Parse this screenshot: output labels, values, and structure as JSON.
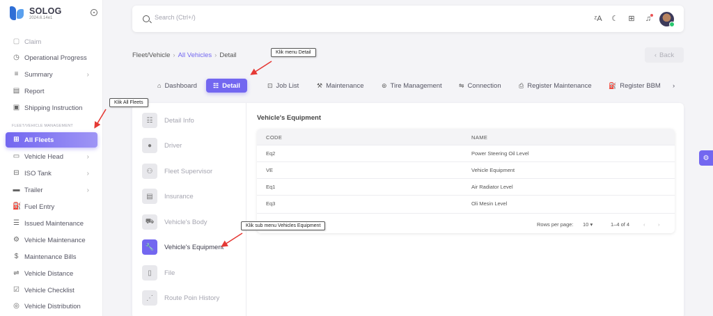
{
  "app": {
    "name": "SOLOG",
    "version": "2024.6.14e1"
  },
  "sidebar": {
    "items": [
      {
        "label": "Claim",
        "icon": "document-icon",
        "muted": true
      },
      {
        "label": "Operational Progress",
        "icon": "clock-icon"
      },
      {
        "label": "Summary",
        "icon": "summary-icon",
        "chevron": true
      },
      {
        "label": "Report",
        "icon": "report-icon"
      },
      {
        "label": "Shipping Instruction",
        "icon": "instruction-icon"
      }
    ],
    "section_label": "FLEET/VEHICLE MANAGEMENT",
    "fleet_items": [
      {
        "label": "All Fleets",
        "icon": "fleet-icon",
        "active": true
      },
      {
        "label": "Vehicle Head",
        "icon": "truck-icon",
        "chevron": true
      },
      {
        "label": "ISO Tank",
        "icon": "tank-icon",
        "chevron": true
      },
      {
        "label": "Trailer",
        "icon": "trailer-icon",
        "chevron": true
      },
      {
        "label": "Fuel Entry",
        "icon": "fuel-icon"
      },
      {
        "label": "Issued Maintenance",
        "icon": "issued-icon"
      },
      {
        "label": "Vehicle Maintenance",
        "icon": "maintenance-icon"
      },
      {
        "label": "Maintenance Bills",
        "icon": "bill-icon"
      },
      {
        "label": "Vehicle Distance",
        "icon": "distance-icon"
      },
      {
        "label": "Vehicle Checklist",
        "icon": "checklist-icon"
      },
      {
        "label": "Vehicle Distribution",
        "icon": "distribution-icon"
      }
    ]
  },
  "search": {
    "placeholder": "Search (Ctrl+/)"
  },
  "breadcrumb": {
    "root": "Fleet/Vehicle",
    "link": "All Vehicles",
    "current": "Detail"
  },
  "back_label": "Back",
  "tabs": [
    {
      "label": "Dashboard",
      "icon": "home-icon"
    },
    {
      "label": "Detail",
      "icon": "detail-icon",
      "active": true
    },
    {
      "label": "Job List",
      "icon": "job-icon"
    },
    {
      "label": "Maintenance",
      "icon": "maintenance-icon"
    },
    {
      "label": "Tire Management",
      "icon": "tire-icon"
    },
    {
      "label": "Connection",
      "icon": "connection-icon"
    },
    {
      "label": "Register Maintenance",
      "icon": "register-icon"
    },
    {
      "label": "Register BBM",
      "icon": "bbm-icon"
    }
  ],
  "sub_menu": [
    {
      "label": "Detail Info",
      "icon": "info-icon"
    },
    {
      "label": "Driver",
      "icon": "driver-icon"
    },
    {
      "label": "Fleet Supervisor",
      "icon": "supervisor-icon"
    },
    {
      "label": "Insurance",
      "icon": "insurance-icon"
    },
    {
      "label": "Vehicle's Body",
      "icon": "body-icon"
    },
    {
      "label": "Vehicle's Equipment",
      "icon": "wrench-icon",
      "active": true
    },
    {
      "label": "File",
      "icon": "file-icon"
    },
    {
      "label": "Route Poin History",
      "icon": "route-icon"
    }
  ],
  "equipment": {
    "title": "Vehicle's Equipment",
    "columns": [
      "CODE",
      "NAME"
    ],
    "rows": [
      [
        "Eq2",
        "Power Steering Oil Level"
      ],
      [
        "VE",
        "Vehicle Equipment"
      ],
      [
        "Eq1",
        "Air Radiator Level"
      ],
      [
        "Eq3",
        "Oli Mesin Level"
      ]
    ],
    "rows_per_page_label": "Rows per page:",
    "rows_per_page": "10",
    "range": "1–4 of 4"
  },
  "annotations": {
    "detail": "Klik menu Detail",
    "fleets": "Klik All Fleets",
    "equipment": "Klik sub menu Vehicles Equipment"
  },
  "colors": {
    "primary": "#7367f0",
    "arrow": "#e53935"
  }
}
